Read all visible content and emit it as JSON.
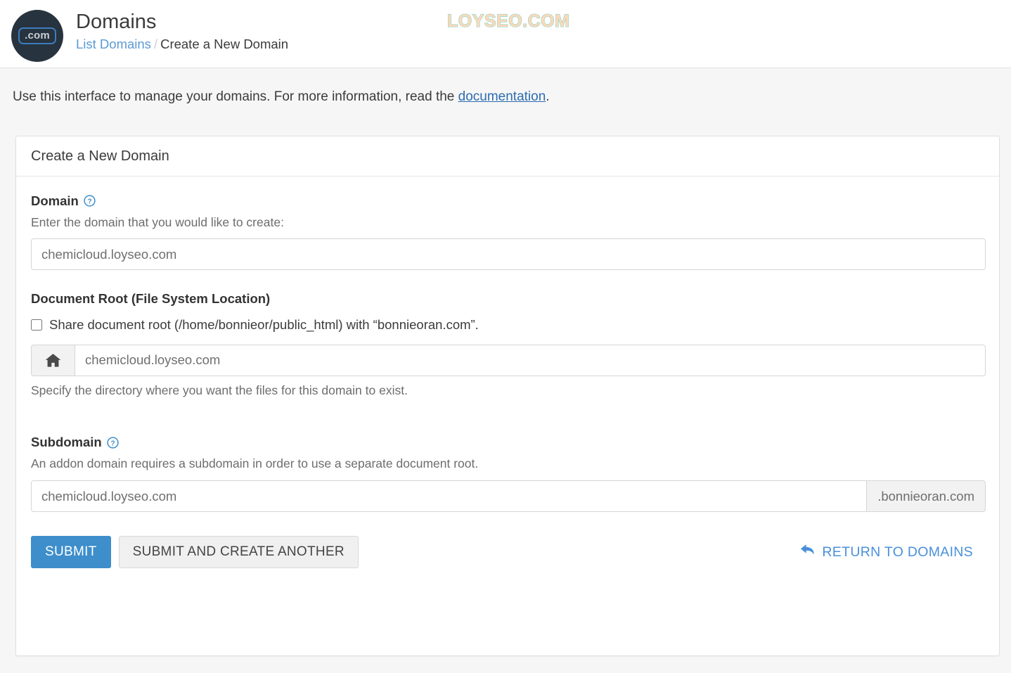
{
  "header": {
    "logo_icon": "dotcom-logo-icon",
    "logo_badge_text": ".com",
    "title": "Domains",
    "breadcrumb": {
      "link_label": "List Domains",
      "separator": "/",
      "current_label": "Create a New Domain"
    }
  },
  "watermark": {
    "text": "LOYSEO.COM",
    "fill_color": "#ffd9b8",
    "stroke_color": "#8fd6cd"
  },
  "description": {
    "text_before": "Use this interface to manage your domains. For more information, read the ",
    "link_label": "documentation",
    "text_after": "."
  },
  "card": {
    "title": "Create a New Domain"
  },
  "domain_field": {
    "label": "Domain",
    "help_icon": "question-circle-icon",
    "hint": "Enter the domain that you would like to create:",
    "value": "chemicloud.loyseo.com",
    "placeholder": "chemicloud.loyseo.com"
  },
  "document_root": {
    "section_title": "Document Root (File System Location)",
    "checkbox_label": "Share document root (/home/bonnieor/public_html) with “bonnieoran.com”.",
    "checkbox_checked": false,
    "prefix_icon": "home-icon",
    "value": "chemicloud.loyseo.com",
    "placeholder": "chemicloud.loyseo.com",
    "hint": "Specify the directory where you want the files for this domain to exist."
  },
  "subdomain_field": {
    "label": "Subdomain",
    "help_icon": "question-circle-icon",
    "hint": "An addon domain requires a subdomain in order to use a separate document root.",
    "value": "chemicloud.loyseo.com",
    "placeholder": "chemicloud.loyseo.com",
    "suffix": ".bonnieoran.com"
  },
  "actions": {
    "submit_label": "SUBMIT",
    "submit_another_label": "SUBMIT AND CREATE ANOTHER",
    "return_label": "RETURN TO DOMAINS",
    "return_icon": "back-arrow-icon",
    "primary_color": "#3d8ecb",
    "link_color": "#4a90d9"
  }
}
